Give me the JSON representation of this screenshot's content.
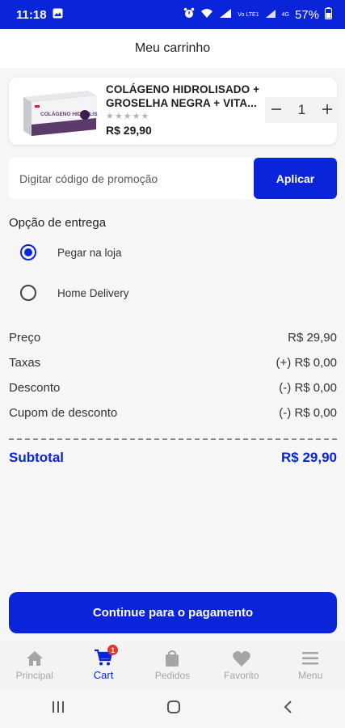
{
  "status": {
    "time": "11:18",
    "battery": "57%",
    "net1": "Vo LTE1",
    "net2": "4G"
  },
  "header": {
    "title": "Meu carrinho"
  },
  "product": {
    "name": "COLÁGENO HIDROLISADO + GROSELHA NEGRA + VITA...",
    "rating_stars": "★★★★★",
    "price": "R$ 29,90",
    "quantity": "1",
    "image_label": "COLÁGENO HIDROLISADO"
  },
  "promo": {
    "placeholder": "Digitar código de promoção",
    "apply_label": "Aplicar"
  },
  "delivery": {
    "title": "Opção de entrega",
    "options": [
      {
        "label": "Pegar na loja",
        "selected": true
      },
      {
        "label": "Home Delivery",
        "selected": false
      }
    ]
  },
  "summary": {
    "rows": [
      {
        "label": "Preço",
        "value": "R$ 29,90"
      },
      {
        "label": "Taxas",
        "value": "(+) R$ 0,00"
      },
      {
        "label": "Desconto",
        "value": "(-) R$ 0,00"
      },
      {
        "label": "Cupom de desconto",
        "value": "(-) R$ 0,00"
      }
    ],
    "subtotal_label": "Subtotal",
    "subtotal_value": "R$ 29,90"
  },
  "checkout": {
    "label": "Continue para o pagamento"
  },
  "nav": {
    "items": [
      {
        "label": "Principal",
        "icon": "home-icon"
      },
      {
        "label": "Cart",
        "icon": "cart-icon",
        "badge": "1"
      },
      {
        "label": "Pedidos",
        "icon": "bag-icon"
      },
      {
        "label": "Favorito",
        "icon": "heart-icon"
      },
      {
        "label": "Menu",
        "icon": "menu-icon"
      }
    ]
  },
  "colors": {
    "primary": "#0a25d9",
    "badge": "#e23535",
    "background": "#f6f6f6"
  }
}
